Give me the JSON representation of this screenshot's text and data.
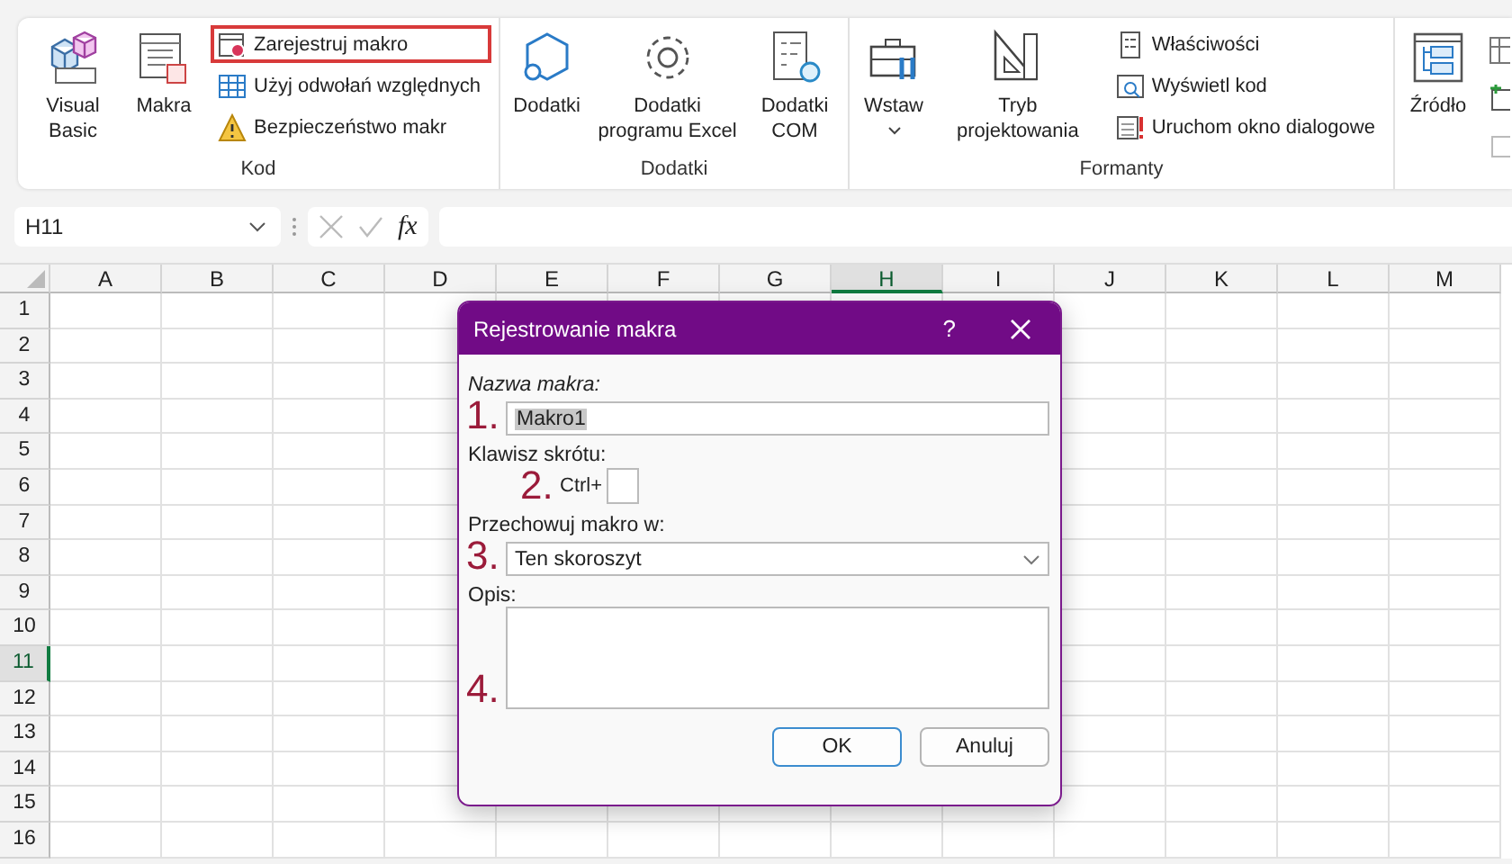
{
  "ribbon": {
    "groups": [
      {
        "label": "Kod",
        "large": [
          {
            "label": "Visual Basic"
          },
          {
            "label": "Makra"
          }
        ],
        "small": [
          {
            "label": "Zarejestruj makro",
            "highlighted": true
          },
          {
            "label": "Użyj odwołań względnych",
            "highlighted": false
          },
          {
            "label": "Bezpieczeństwo makr",
            "highlighted": false
          }
        ]
      },
      {
        "label": "Dodatki",
        "large": [
          {
            "label": "Dodatki"
          },
          {
            "label": "Dodatki programu Excel"
          },
          {
            "label": "Dodatki COM"
          }
        ]
      },
      {
        "label": "Formanty",
        "large": [
          {
            "label": "Wstaw",
            "dropdown": true
          },
          {
            "label": "Tryb projektowania",
            "dropdown": false
          }
        ],
        "small": [
          {
            "label": "Właściwości",
            "highlighted": false
          },
          {
            "label": "Wyświetl kod",
            "highlighted": false
          },
          {
            "label": "Uruchom okno dialogowe",
            "highlighted": false
          }
        ]
      },
      {
        "large": [
          {
            "label": "Źródło"
          }
        ]
      }
    ]
  },
  "formula_bar": {
    "name_box": "H11",
    "fx": "fx"
  },
  "columns": [
    {
      "label": "A",
      "selected": false
    },
    {
      "label": "B",
      "selected": false
    },
    {
      "label": "C",
      "selected": false
    },
    {
      "label": "D",
      "selected": false
    },
    {
      "label": "E",
      "selected": false
    },
    {
      "label": "F",
      "selected": false
    },
    {
      "label": "G",
      "selected": false
    },
    {
      "label": "H",
      "selected": true
    },
    {
      "label": "I",
      "selected": false
    },
    {
      "label": "J",
      "selected": false
    },
    {
      "label": "K",
      "selected": false
    },
    {
      "label": "L",
      "selected": false
    },
    {
      "label": "M",
      "selected": false
    }
  ],
  "rows": [
    {
      "label": "1",
      "selected": false
    },
    {
      "label": "2",
      "selected": false
    },
    {
      "label": "3",
      "selected": false
    },
    {
      "label": "4",
      "selected": false
    },
    {
      "label": "5",
      "selected": false
    },
    {
      "label": "6",
      "selected": false
    },
    {
      "label": "7",
      "selected": false
    },
    {
      "label": "8",
      "selected": false
    },
    {
      "label": "9",
      "selected": false
    },
    {
      "label": "10",
      "selected": false
    },
    {
      "label": "11",
      "selected": true
    },
    {
      "label": "12",
      "selected": false
    },
    {
      "label": "13",
      "selected": false
    },
    {
      "label": "14",
      "selected": false
    },
    {
      "label": "15",
      "selected": false
    },
    {
      "label": "16",
      "selected": false
    }
  ],
  "dialog": {
    "title": "Rejestrowanie makra",
    "help": "?",
    "name_label": "Nazwa makra:",
    "name_marker": "1.",
    "name_value": "Makro1",
    "shortcut_label": "Klawisz skrótu:",
    "shortcut_marker": "2.",
    "shortcut_prefix": "Ctrl+",
    "store_label": "Przechowuj makro w:",
    "store_marker": "3.",
    "store_value": "Ten skoroszyt",
    "desc_label": "Opis:",
    "desc_marker": "4.",
    "buttons": [
      {
        "label": "OK"
      },
      {
        "label": "Anuluj"
      }
    ]
  }
}
